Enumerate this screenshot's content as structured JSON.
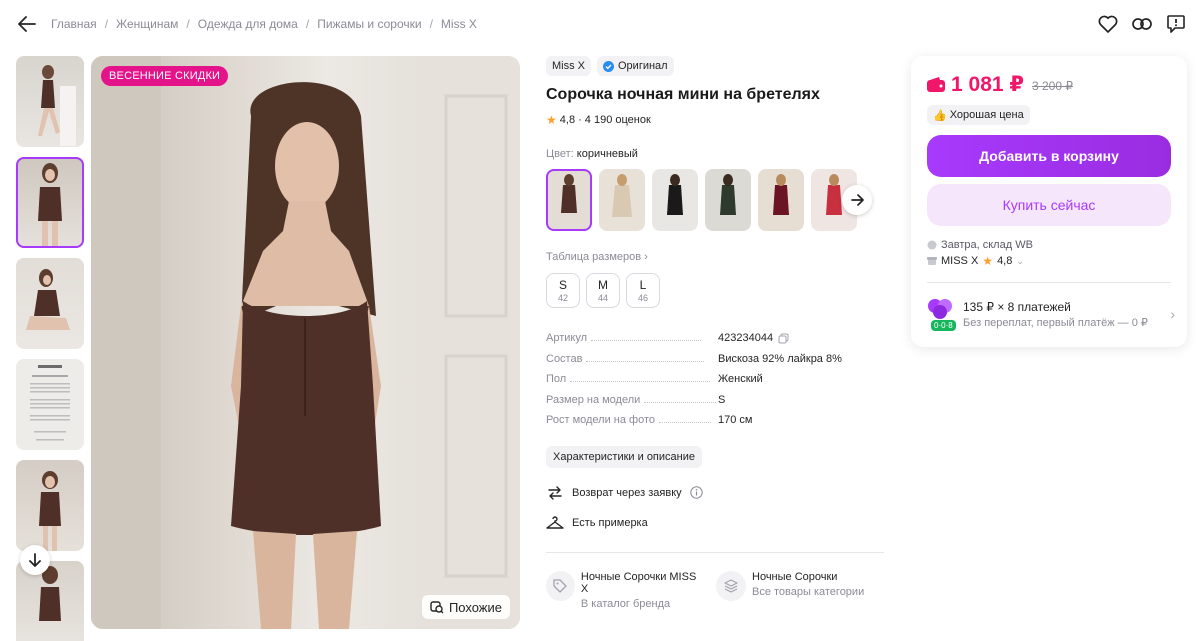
{
  "breadcrumbs": [
    "Главная",
    "Женщинам",
    "Одежда для дома",
    "Пижамы и сорочки",
    "Miss X"
  ],
  "photo": {
    "promo": "ВЕСЕННИЕ СКИДКИ",
    "similar": "Похожие"
  },
  "product": {
    "brand": "Miss X",
    "original": "Оригинал",
    "title": "Сорочка ночная мини на бретелях",
    "rating": "4,8",
    "reviews": "· 4 190 оценок",
    "color_label": "Цвет:",
    "color_value": "коричневый",
    "size_table": "Таблица размеров",
    "sizes": [
      {
        "label": "S",
        "ru": "42"
      },
      {
        "label": "M",
        "ru": "44"
      },
      {
        "label": "L",
        "ru": "46"
      }
    ],
    "specs": [
      {
        "key": "Артикул",
        "value": "423234044"
      },
      {
        "key": "Состав",
        "value": "Вискоза 92% лайкра 8%"
      },
      {
        "key": "Пол",
        "value": "Женский"
      },
      {
        "key": "Размер на модели",
        "value": "S"
      },
      {
        "key": "Рост модели на фото",
        "value": "170 см"
      }
    ],
    "characteristics": "Характеристики и описание",
    "return": "Возврат через заявку",
    "fitting": "Есть примерка",
    "categories": [
      {
        "title": "Ночные Сорочки MISS X",
        "sub": "В каталог бренда"
      },
      {
        "title": "Ночные Сорочки",
        "sub": "Все товары категории"
      }
    ]
  },
  "buy": {
    "price": "1 081 ₽",
    "old_price": "3 200 ₽",
    "good_price": "Хорошая цена",
    "add_to_cart": "Добавить в корзину",
    "buy_now": "Купить сейчас",
    "delivery": "Завтра, склад WB",
    "seller": "MISS X",
    "seller_rating": "4,8",
    "installment": "135 ₽ × 8 платежей",
    "installment_sub": "Без переплат, первый платёж — 0 ₽",
    "installment_badge": "0·0·8"
  },
  "colors": {
    "accent": "#a73afd",
    "price": "#f0176a",
    "promo": "#e5138a"
  }
}
